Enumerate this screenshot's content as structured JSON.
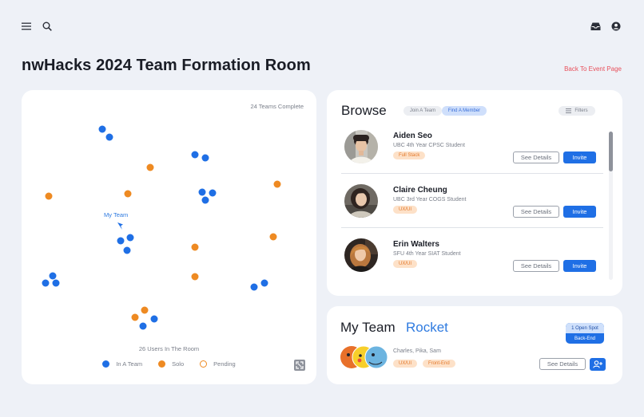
{
  "header": {
    "menu_icon": "menu-icon",
    "search_icon": "search-icon",
    "inbox_icon": "inbox-icon",
    "profile_icon": "profile-icon",
    "title": "nwHacks 2024 Team Formation Room",
    "back_link": "Back To Event Page"
  },
  "room_map": {
    "teams_complete": "24 Teams Complete",
    "users_count": "26 Users In The Room",
    "my_team_label": "My Team",
    "legend": [
      {
        "label": "In A Team",
        "color": "#1f6fe5",
        "style": "filled"
      },
      {
        "label": "Solo",
        "color": "#ee8a22",
        "style": "filled"
      },
      {
        "label": "Pending",
        "color": "#ee8a22",
        "style": "outline"
      }
    ],
    "expand_icon": "expand-icon"
  },
  "browse": {
    "title": "Browse",
    "tabs": [
      {
        "label": "Join A Team",
        "active": false
      },
      {
        "label": "Find A Member",
        "active": true
      }
    ],
    "filters_label": "Filters",
    "members": [
      {
        "name": "Aiden Seo",
        "desc": "UBC 4th Year CPSC Student",
        "tag": "Full Stack",
        "details": "See Details",
        "invite": "Invite"
      },
      {
        "name": "Claire Cheung",
        "desc": "UBC 3rd Year COGS Student",
        "tag": "UX/UI",
        "details": "See Details",
        "invite": "Invite"
      },
      {
        "name": "Erin Walters",
        "desc": "SFU 4th Year SIAT Student",
        "tag": "UX/UI",
        "details": "See Details",
        "invite": "Invite"
      }
    ]
  },
  "my_team": {
    "title": "My Team",
    "name": "Rocket",
    "open_spot": "1 Open Spot",
    "open_role": "Back-End",
    "members": "Charles, Pika, Sam",
    "tags": [
      "UX/UI",
      "Front-End"
    ],
    "details": "See Details",
    "add_icon": "add-user-icon"
  },
  "colors": {
    "accent": "#1f6fe5",
    "solo": "#ee8a22",
    "link": "#e8505b"
  }
}
